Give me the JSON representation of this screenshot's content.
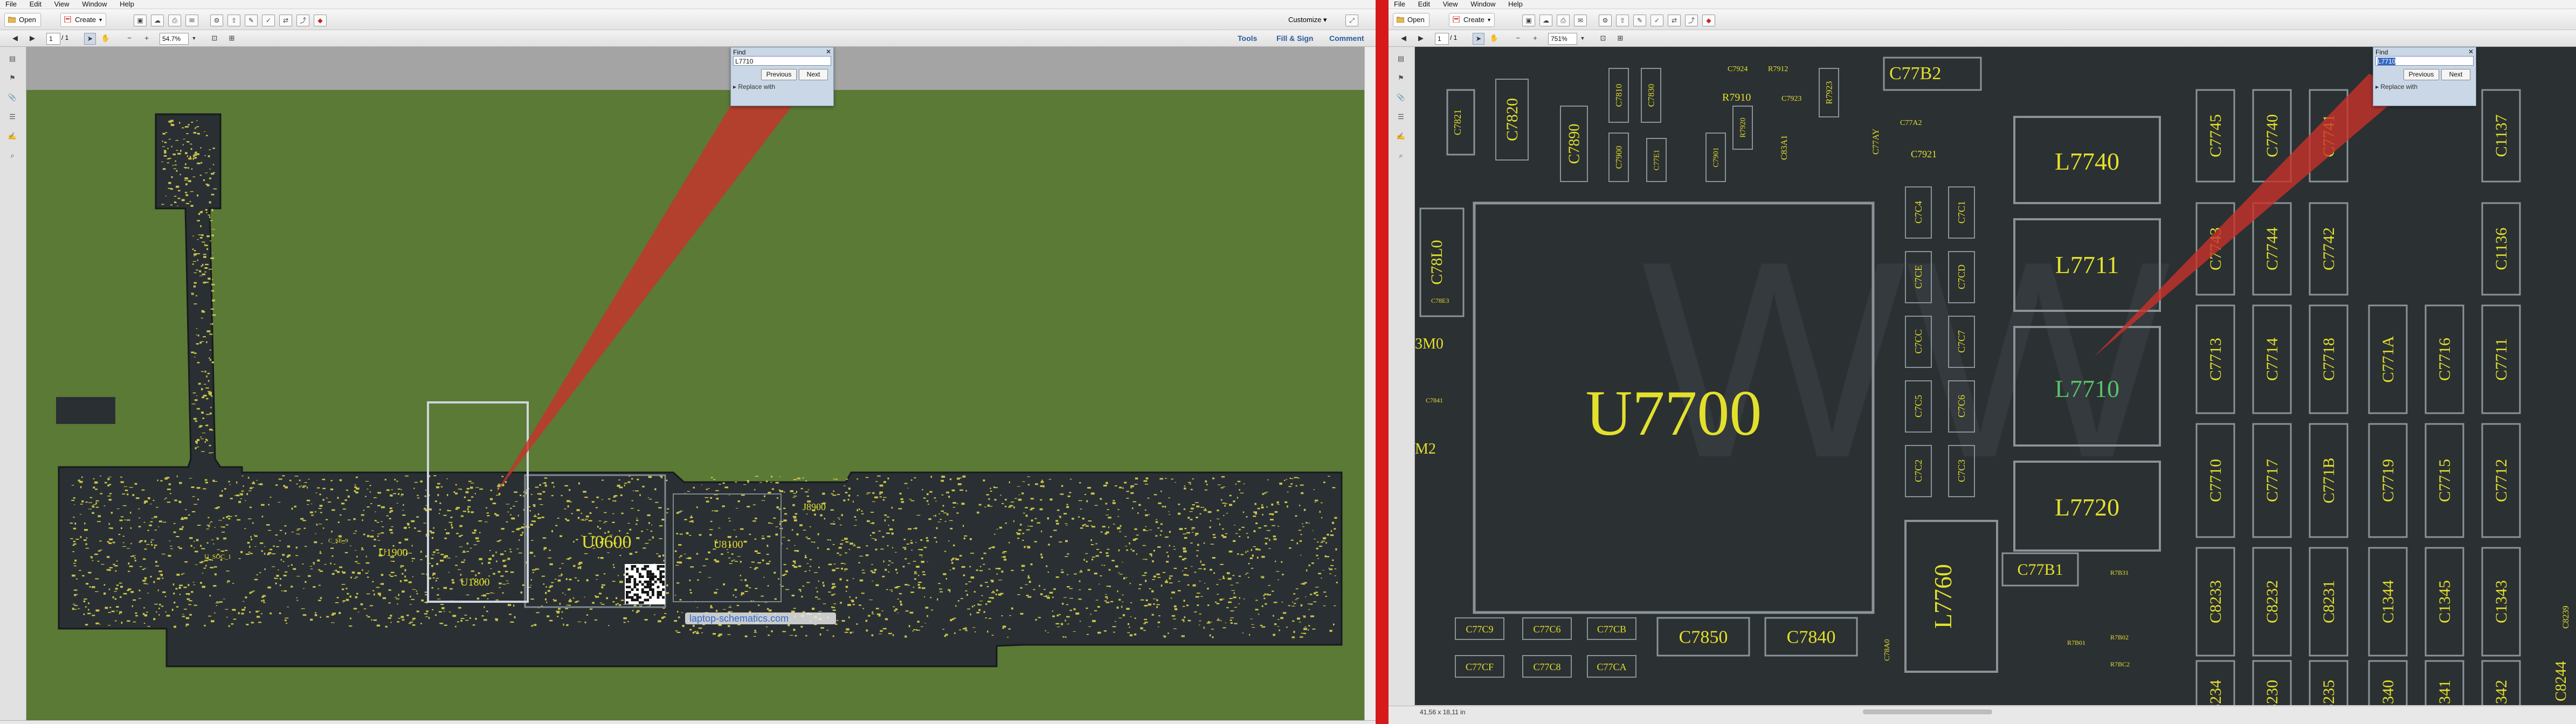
{
  "left": {
    "menu": [
      "File",
      "Edit",
      "View",
      "Window",
      "Help"
    ],
    "toolbar": {
      "open_label": "Open",
      "create_label": "Create",
      "customize_label": "Customize"
    },
    "nav": {
      "page_current": "1",
      "page_total": "/ 1",
      "zoom": "54.7%"
    },
    "tabs": {
      "tools": "Tools",
      "fill_sign": "Fill & Sign",
      "comment": "Comment"
    },
    "find": {
      "title": "Find",
      "query": "L7710",
      "previous": "Previous",
      "next": "Next",
      "replace": "Replace with"
    },
    "board": {
      "labels": [
        "U1900",
        "U1800",
        "U0600",
        "U8100",
        "J8900",
        "U_SOC_1",
        "C_SE_9",
        "laptop-schematics.com"
      ],
      "watermark": "laptop-schematics.com"
    }
  },
  "right": {
    "menu": [
      "File",
      "Edit",
      "View",
      "Window",
      "Help"
    ],
    "toolbar": {
      "open_label": "Open",
      "create_label": "Create"
    },
    "nav": {
      "page_current": "1",
      "page_total": "/ 1",
      "zoom": "751%"
    },
    "find": {
      "title": "Find",
      "query": "L7710",
      "previous": "Previous",
      "next": "Next",
      "replace": "Replace with"
    },
    "status": {
      "dimensions": "41,56 x 18,11 in"
    },
    "board": {
      "main_chip": "U7700",
      "inductors": [
        "L7740",
        "L7711",
        "L7710",
        "L7720",
        "L7760"
      ],
      "found": "L7710",
      "top_labels": [
        "C7820",
        "C7890",
        "C7810",
        "C7830",
        "R7910",
        "C7924",
        "C7923",
        "R7912",
        "R7923",
        "C77B2",
        "C77A2",
        "C77E1",
        "C7921",
        "R7920",
        "C7901",
        "C7900"
      ],
      "left_labels": [
        "C78L0",
        "C78E3",
        "3M0",
        "C7841",
        "M2"
      ],
      "caps_grid_labels": [
        "C7745",
        "C7740",
        "C7741",
        "C1137",
        "C7743",
        "C7744",
        "C7742",
        "C1136",
        "C7713",
        "C7714",
        "C7718",
        "C771A",
        "C7716",
        "C7711",
        "C7710",
        "C7717",
        "C771B",
        "C7719",
        "C7715",
        "C7712",
        "C8233",
        "C8232",
        "C8231",
        "C1344",
        "C1345",
        "C1343",
        "C8234",
        "C8230",
        "C8235",
        "C1340",
        "C1341",
        "C1342"
      ],
      "col_labels": [
        "C7C4",
        "C7C1",
        "C7CE",
        "C7CD",
        "C7CC",
        "C7C7",
        "C7C5",
        "C7C6",
        "C7C2",
        "C7C3"
      ],
      "bottom_labels": [
        "C7850",
        "C7840",
        "C77B1",
        "C77C9",
        "C77C6",
        "C77CB",
        "C77CF",
        "C77C8",
        "C77CA",
        "C78A0",
        "R7B31",
        "R7B02",
        "R7B01",
        "R7BC2",
        "C8244",
        "C8239"
      ],
      "small_labels": [
        "C83A1",
        "C77AY",
        "C7821"
      ]
    }
  }
}
